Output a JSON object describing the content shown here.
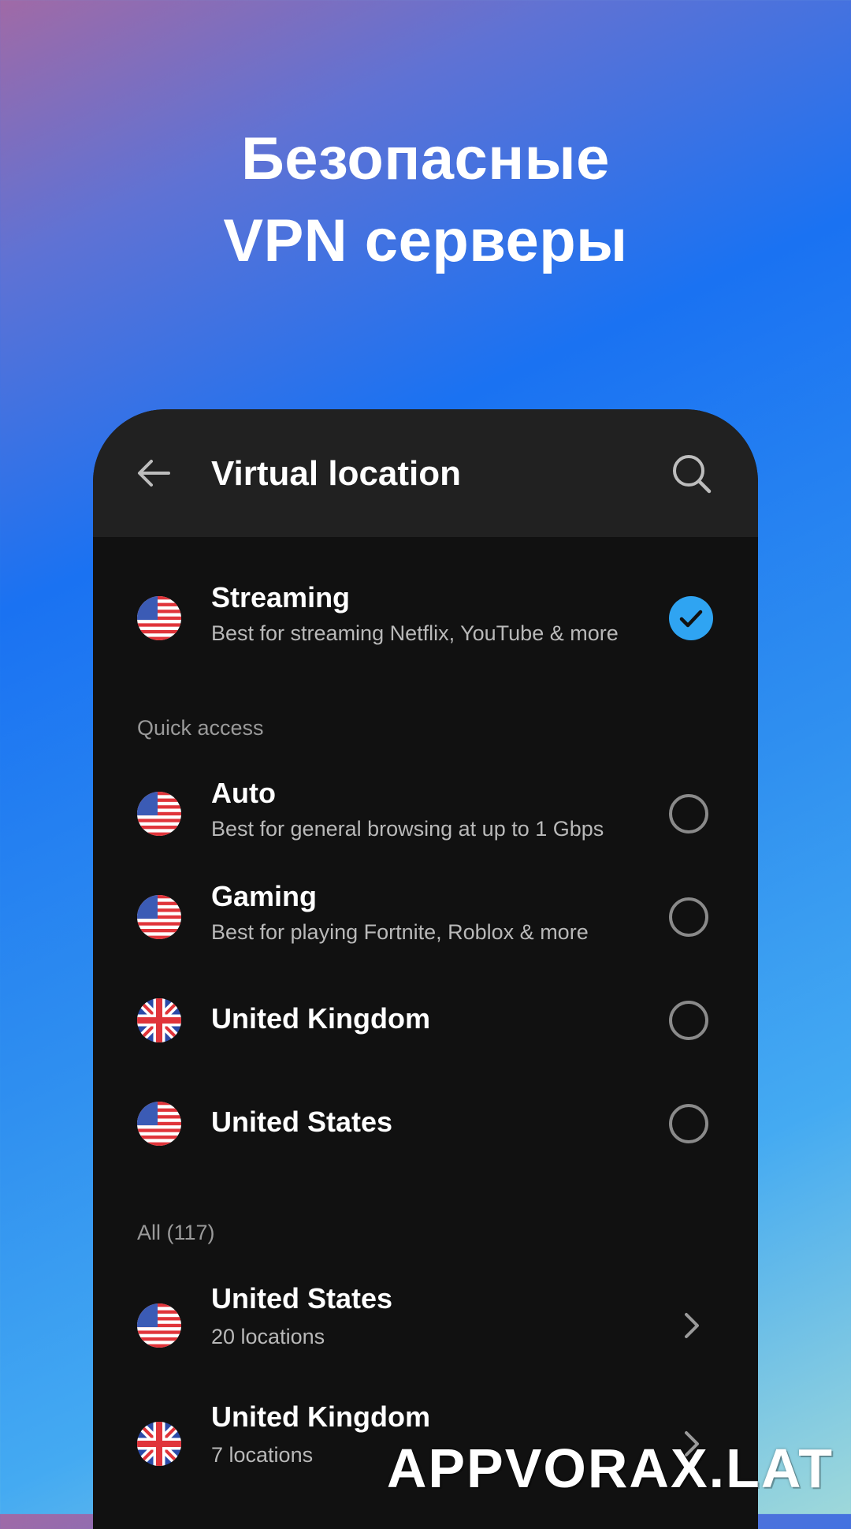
{
  "promo": {
    "headline_line1": "Безопасные",
    "headline_line2": "VPN серверы"
  },
  "appbar": {
    "title": "Virtual location",
    "back_icon": "arrow-left-icon",
    "search_icon": "search-icon"
  },
  "selected": {
    "title": "Streaming",
    "subtitle": "Best for streaming Netflix, YouTube & more",
    "flag": "us-flag-icon",
    "state": "selected"
  },
  "quick_access": {
    "label": "Quick access",
    "items": [
      {
        "title": "Auto",
        "subtitle": "Best for general browsing at up to 1 Gbps",
        "flag": "us-flag-icon",
        "state": "unselected"
      },
      {
        "title": "Gaming",
        "subtitle": "Best for playing Fortnite, Roblox & more",
        "flag": "us-flag-icon",
        "state": "unselected"
      },
      {
        "title": "United Kingdom",
        "subtitle": "",
        "flag": "uk-flag-icon",
        "state": "unselected"
      },
      {
        "title": "United States",
        "subtitle": "",
        "flag": "us-flag-icon",
        "state": "unselected"
      }
    ]
  },
  "all": {
    "label": "All (117)",
    "items": [
      {
        "title": "United States",
        "subtitle": "20 locations",
        "flag": "us-flag-icon"
      },
      {
        "title": "United Kingdom",
        "subtitle": "7 locations",
        "flag": "uk-flag-icon"
      }
    ]
  },
  "watermark": "APPVORAX.LAT",
  "colors": {
    "accent": "#2fa4f2",
    "panel_bg": "#111111",
    "appbar_bg": "#212121"
  }
}
